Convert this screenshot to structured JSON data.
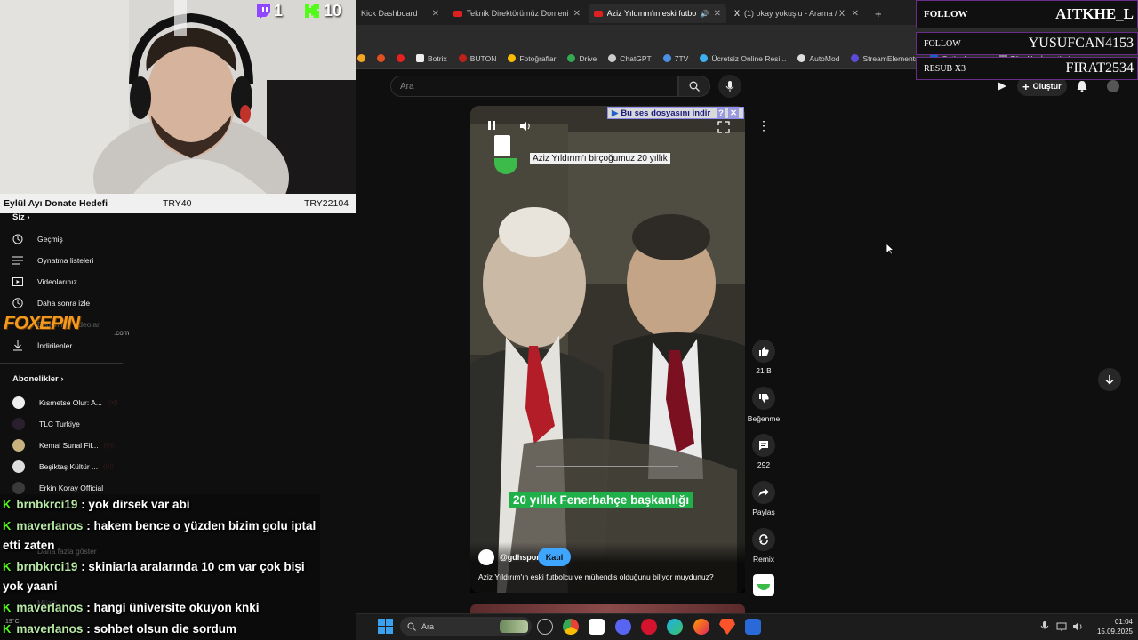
{
  "browser": {
    "tabs": [
      {
        "label": "Kick Dashboard",
        "active": false
      },
      {
        "label": "Teknik Direktörümüz Domenico",
        "active": false
      },
      {
        "label": "Aziz Yıldırım'ın eski futbolc",
        "active": true
      },
      {
        "label": "(1) okay yokuşlu - Arama / X",
        "active": false
      }
    ],
    "new_tab": "+",
    "bookmarks": [
      "Botrix",
      "BUTON",
      "Fotoğraflar",
      "Drive",
      "ChatGPT",
      "7TV",
      "Ücretsiz Online Resi...",
      "AutoMod",
      "StreamElements",
      "Outlook",
      "Tüm Yer İşaretleri"
    ]
  },
  "youtube": {
    "search_placeholder": "Ara",
    "create_label": "Oluştur",
    "sidebar": {
      "section_you": "Siz",
      "you_items": [
        "Geçmiş",
        "Oynatma listeleri",
        "Videolarınız",
        "Daha sonra izle",
        "Beğenilen videolar",
        "İndirilenler"
      ],
      "section_subs": "Abonelikler",
      "subs": [
        "Kısmetse Olur: A...",
        "TLC Turkiye",
        "Kemal Sunal Fil...",
        "Beşiktaş Kültür ...",
        "Erkin Koray Official"
      ],
      "show_more": "Daha fazla göster",
      "more_label": "Müzik"
    },
    "short": {
      "caption_top": "Aziz Yıldırım'ı birçoğumuz 20 yıllık",
      "caption_main": "20 yıllık Fenerbahçe başkanlığı",
      "download_bar": "Bu ses dosyasını indir",
      "download_help": "?",
      "channel": "@gdhspor",
      "join_label": "Katıl",
      "description": "Aziz Yıldırım'ın eski futbolcu ve mühendis olduğunu biliyor muydunuz?"
    },
    "rail": {
      "likes": "21 B",
      "dislike_label": "Beğenme",
      "comments": "292",
      "share_label": "Paylaş",
      "remix_label": "Remix"
    }
  },
  "overlay": {
    "twitch_count": "1",
    "kick_count": "10",
    "donate_goal_label": "Eylül Ayı Donate Hedefi",
    "donate_current": "TRY40",
    "donate_target": "TRY22104",
    "sponsor_logo": "FOXEPIN",
    "sponsor_suffix": ".com",
    "alerts": [
      {
        "type": "FOLLOW",
        "user": "AITKHE_L"
      },
      {
        "type": "FOLLOW",
        "user": "YUSUFCAN4153"
      },
      {
        "type": "RESUB X3",
        "user": "FIRAT2534"
      }
    ],
    "chat": [
      {
        "user": "brnbkrci19",
        "message": ": yok dirsek var abi"
      },
      {
        "user": "maverlanos",
        "message": ": hakem bence o yüzden bizim golu iptal"
      },
      {
        "user": "",
        "message": "etti zaten"
      },
      {
        "user": "brnbkrci19",
        "message": ": skiniarla aralarında 10 cm var çok bişi"
      },
      {
        "user": "",
        "message": "yok yaani"
      },
      {
        "user": "maverlanos",
        "message": ": hangi üniversite okuyon knki"
      },
      {
        "user": "maverlanos",
        "message": ": sohbet olsun die sordum"
      }
    ]
  },
  "taskbar": {
    "search_label": "Ara",
    "temperature": "19°C",
    "time": "01:04",
    "date": "15.09.2025"
  },
  "colors": {
    "youtube_red": "#e02020",
    "kick_green": "#53fc18",
    "twitch_purple": "#9146ff",
    "caption_green": "#1fb04a",
    "join_blue": "#3ea6ff"
  }
}
